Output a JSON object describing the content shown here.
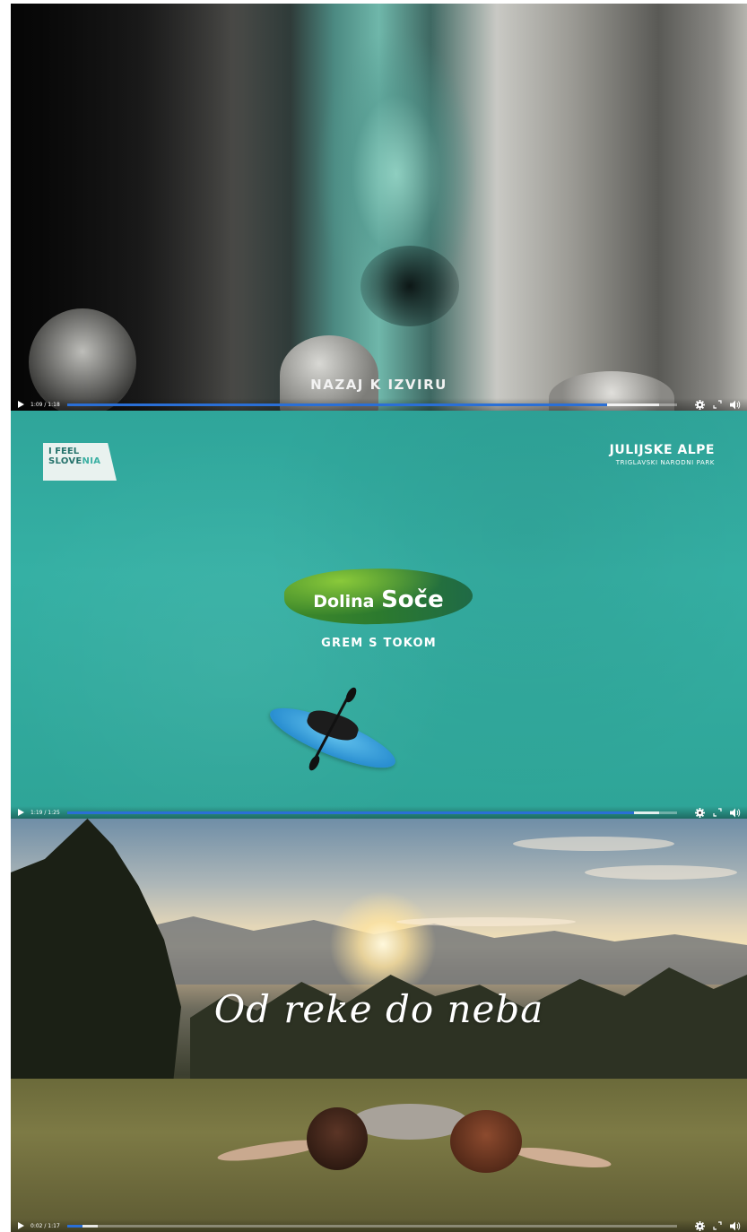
{
  "videos": [
    {
      "caption": "NAZAJ K IZVIRU",
      "time": "1:09 / 1:18",
      "progress": 0.885,
      "buffered": 0.97
    },
    {
      "logo_left_line1": "I FEEL",
      "logo_left_line2a": "SLOVE",
      "logo_left_line2b": "NIA",
      "logo_right_title": "JULIJSKE ALPE",
      "logo_right_subtitle": "TRIGLAVSKI NARODNI PARK",
      "brand_word1": "Dolina",
      "brand_word2": "Soče",
      "caption": "GREM S TOKOM",
      "time": "1:19 / 1:25",
      "progress": 0.929,
      "buffered": 0.97
    },
    {
      "caption": "Od reke do neba",
      "time": "0:02 / 1:17",
      "progress": 0.026,
      "buffered": 0.05
    }
  ],
  "icons": {
    "play": "play-icon",
    "settings": "gear-icon",
    "fullscreen": "fullscreen-icon",
    "volume": "volume-icon"
  },
  "colors": {
    "progress": "#2a6fd6",
    "river": "#33ab9f",
    "brand_green": "#2c7a2e"
  }
}
